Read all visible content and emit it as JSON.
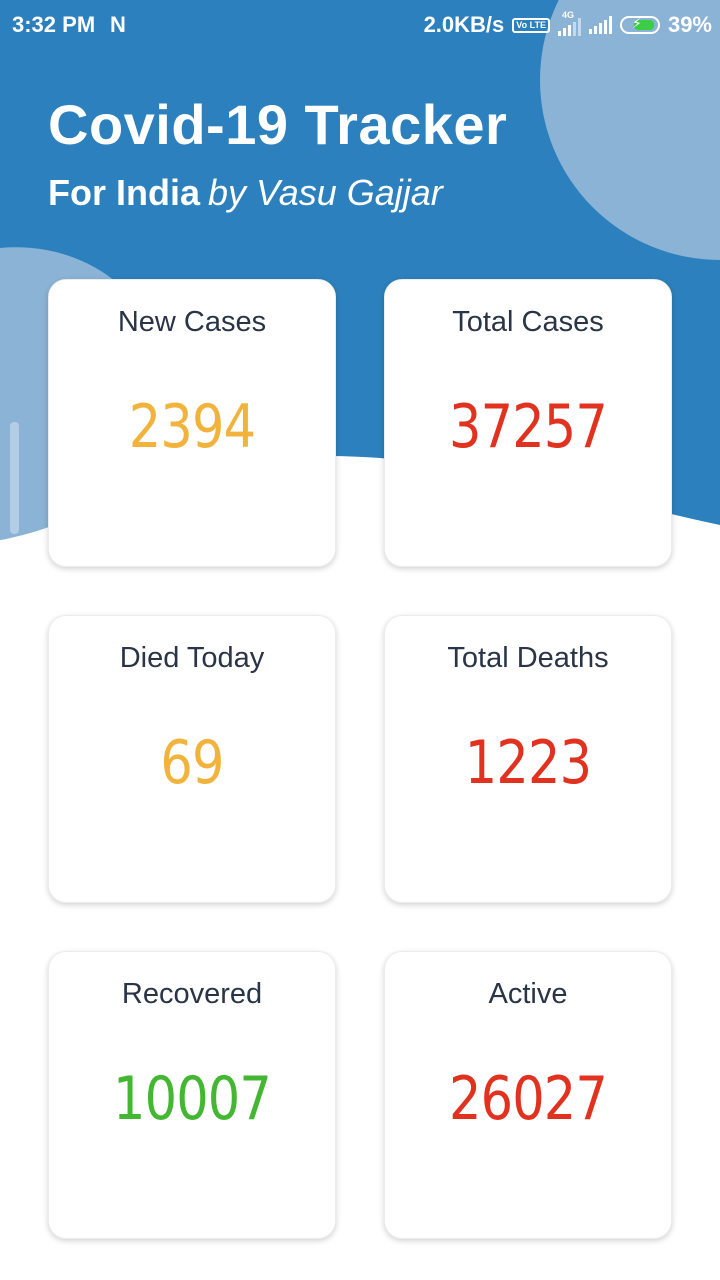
{
  "status_bar": {
    "time": "3:32 PM",
    "notification_glyph": "N",
    "net_speed": "2.0KB/s",
    "volte": "Vo LTE",
    "net_type": "4G",
    "battery": "39%",
    "colors": {
      "battery_fill": "#3dcc45"
    }
  },
  "header": {
    "title": "Covid-19 Tracker",
    "subtitle_bold": "For India",
    "subtitle_italic": "by Vasu Gajjar",
    "colors": {
      "background": "#2b80bd",
      "circle": "#8ab3d6"
    }
  },
  "cards": [
    {
      "label": "New Cases",
      "value": "2394",
      "color": "#f2b33d"
    },
    {
      "label": "Total Cases",
      "value": "37257",
      "color": "#e0321e"
    },
    {
      "label": "Died Today",
      "value": "69",
      "color": "#f2b33d"
    },
    {
      "label": "Total Deaths",
      "value": "1223",
      "color": "#e0321e"
    },
    {
      "label": "Recovered",
      "value": "10007",
      "color": "#43b731"
    },
    {
      "label": "Active",
      "value": "26027",
      "color": "#e0321e"
    }
  ]
}
